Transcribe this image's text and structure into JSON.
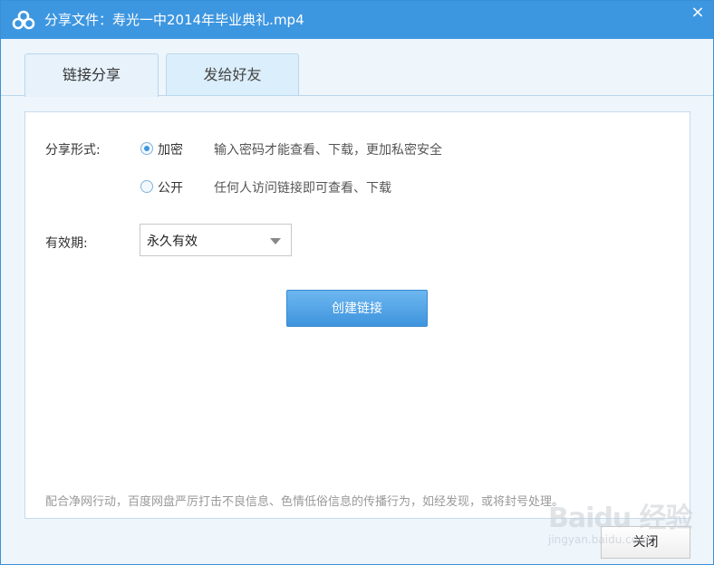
{
  "window": {
    "title": "分享文件：寿光一中2014年毕业典礼.mp4",
    "close_glyph": "×",
    "title_icon": "baidu-cloud-icon"
  },
  "tabs": [
    {
      "label": "链接分享",
      "active": true
    },
    {
      "label": "发给好友",
      "active": false
    }
  ],
  "share_form": {
    "label": "分享形式:",
    "options": [
      {
        "label": "加密",
        "description": "输入密码才能查看、下载，更加私密安全",
        "selected": true
      },
      {
        "label": "公开",
        "description": "任何人访问链接即可查看、下载",
        "selected": false
      }
    ]
  },
  "validity": {
    "label": "有效期:",
    "selected": "永久有效"
  },
  "create_button": "创建链接",
  "notice": "配合净网行动，百度网盘严厉打击不良信息、色情低俗信息的传播行为，如经发现，或将封号处理。",
  "close_button": "关闭",
  "watermark": {
    "logo": "Baidu 经验",
    "url": "jingyan.baidu.com"
  },
  "colors": {
    "titlebar": "#3d96e0",
    "accent": "#3d96e0",
    "button_top": "#6db7f0",
    "button_bottom": "#3f94dd"
  }
}
